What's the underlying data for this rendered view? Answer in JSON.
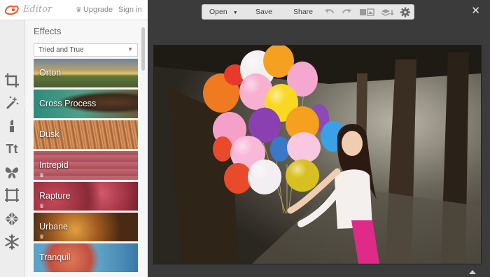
{
  "app": {
    "title": "Editor",
    "upgrade_label": "Upgrade",
    "signin_label": "Sign in"
  },
  "tools": [
    {
      "name": "crop-icon"
    },
    {
      "name": "magic-wand-icon",
      "active": true
    },
    {
      "name": "lipstick-icon"
    },
    {
      "name": "text-icon",
      "glyph": "Tt"
    },
    {
      "name": "butterfly-icon"
    },
    {
      "name": "frame-icon"
    },
    {
      "name": "texture-icon"
    },
    {
      "name": "snowflake-icon"
    }
  ],
  "effects": {
    "heading": "Effects",
    "category": "Tried and True",
    "items": [
      {
        "label": "Orton",
        "premium": false
      },
      {
        "label": "Cross Process",
        "premium": false
      },
      {
        "label": "Dusk",
        "premium": false
      },
      {
        "label": "Intrepid",
        "premium": true
      },
      {
        "label": "Rapture",
        "premium": true
      },
      {
        "label": "Urbane",
        "premium": true
      },
      {
        "label": "Tranquil",
        "premium": true
      }
    ]
  },
  "toolbar": {
    "open_label": "Open",
    "save_label": "Save",
    "share_label": "Share",
    "icons": [
      "undo-icon",
      "redo-icon",
      "compare-icon",
      "layers-icon",
      "gear-icon"
    ]
  },
  "colors": {
    "accent": "#e8552b",
    "workspace_bg": "#3b3b3b",
    "panel_bg": "#f4f4f4"
  }
}
